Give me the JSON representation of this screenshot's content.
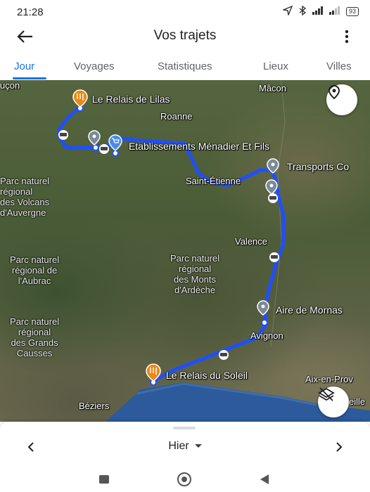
{
  "status_bar": {
    "time": "21:28",
    "icons": [
      "location-arrow-icon",
      "bluetooth-icon",
      "signal-icon",
      "signal-icon",
      "battery-icon"
    ],
    "battery_label": "93"
  },
  "app_bar": {
    "title": "Vos trajets",
    "back_icon": "arrow-left-icon",
    "menu_icon": "more-vert-icon"
  },
  "tabs": [
    {
      "label": "Jour",
      "active": true
    },
    {
      "label": "Voyages",
      "active": false
    },
    {
      "label": "Statistiques",
      "active": false
    },
    {
      "label": "Lieux",
      "active": false
    },
    {
      "label": "Villes",
      "active": false
    }
  ],
  "map": {
    "route_color": "#1f4fff",
    "places": [
      "uçon",
      "Mâcon",
      "Roanne",
      "Saint-Étienne",
      "Valence",
      "Avignon",
      "Aix-en-Prov",
      "Béziers",
      "eille"
    ],
    "parks": {
      "auvergne": "Parc naturel\nrégional\ndes Volcans\nd'Auvergne",
      "aubrac": "Parc naturel\nrégional de\nl'Aubrac",
      "ardeche": "Parc naturel\nrégional\ndes Monts\nd'Ardèche",
      "causses": "Parc naturel\nrégional\ndes Grands\nCausses"
    },
    "stops": [
      {
        "name": "Le Relais de Lilas",
        "type": "restaurant"
      },
      {
        "name": "Etablissements Ménadier Et Fils",
        "type": "shopping"
      },
      {
        "name": "Transports Co",
        "type": "place"
      },
      {
        "name": "Aire de Mornas",
        "type": "place"
      },
      {
        "name": "Le Relais du Soleil",
        "type": "restaurant"
      }
    ],
    "location_button_icon": "map-pin-icon",
    "layers_button_icon": "layers-off-icon"
  },
  "bottom": {
    "day_label": "Hier",
    "prev_icon": "chevron-left-icon",
    "next_icon": "chevron-right-icon"
  },
  "system_nav": [
    "square-icon",
    "circle-icon",
    "triangle-back-icon"
  ]
}
